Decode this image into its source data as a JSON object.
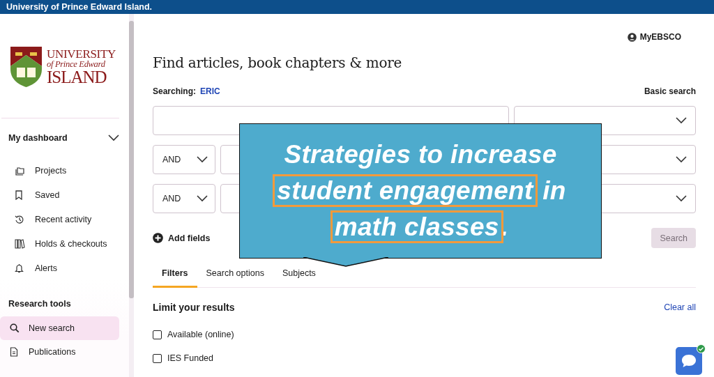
{
  "top_bar": {
    "title": "University of Prince Edward Island."
  },
  "logo": {
    "lines": [
      "UNIVERSITY",
      "of Prince Edward",
      "ISLAND"
    ]
  },
  "sidebar": {
    "dashboard": {
      "title": "My dashboard",
      "expanded": true
    },
    "dashboard_items": [
      {
        "kind": "projects",
        "label": "Projects"
      },
      {
        "kind": "saved",
        "label": "Saved"
      },
      {
        "kind": "recent",
        "label": "Recent activity"
      },
      {
        "kind": "holds",
        "label": "Holds & checkouts"
      },
      {
        "kind": "alerts",
        "label": "Alerts"
      }
    ],
    "research_title": "Research tools",
    "research_items": [
      {
        "kind": "search",
        "label": "New search",
        "selected": true
      },
      {
        "kind": "publications",
        "label": "Publications",
        "selected": false
      }
    ]
  },
  "account": {
    "label": "MyEBSCO"
  },
  "heading": "Find articles, book chapters & more",
  "searching": {
    "label": "Searching:",
    "database": "ERIC",
    "mode": "Basic search"
  },
  "search_rows": [
    {
      "operator": null
    },
    {
      "operator": "AND"
    },
    {
      "operator": "AND"
    }
  ],
  "add_fields": "Add fields",
  "search_button": {
    "label": "Search",
    "disabled": true
  },
  "tabs": [
    {
      "label": "Filters",
      "selected": true
    },
    {
      "label": "Search options",
      "selected": false
    },
    {
      "label": "Subjects",
      "selected": false
    }
  ],
  "filters": {
    "title": "Limit your results",
    "clear": "Clear all",
    "options": [
      {
        "label": "Available (online)",
        "checked": false
      },
      {
        "label": "IES Funded",
        "checked": false
      }
    ]
  },
  "callout": {
    "lines": [
      [
        {
          "text": "Strategies to increase",
          "highlighted": false
        }
      ],
      [
        {
          "text": "student engagement",
          "highlighted": true
        },
        {
          "text": " in",
          "highlighted": false
        }
      ],
      [
        {
          "text": "math classes",
          "highlighted": true
        },
        {
          "text": ".",
          "highlighted": false
        }
      ]
    ]
  }
}
